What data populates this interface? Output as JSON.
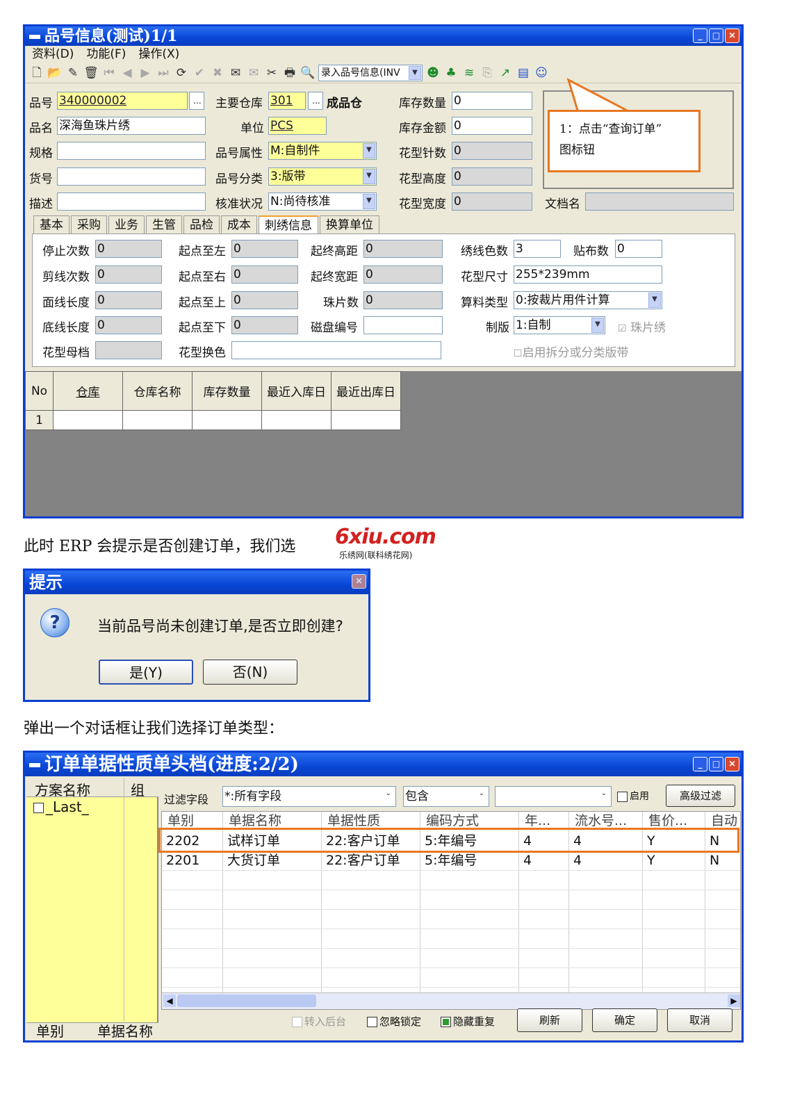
{
  "window1": {
    "title": "品号信息(测试)1/1",
    "menus": [
      "资料(D)",
      "功能(F)",
      "操作(X)"
    ],
    "toolbar_select": "录入品号信息(INV",
    "fields": {
      "item_no_label": "品号",
      "item_no": "340000002",
      "item_name_label": "品名",
      "item_name": "深海鱼珠片绣",
      "spec_label": "规格",
      "spec": "",
      "goods_no_label": "货号",
      "goods_no": "",
      "desc_label": "描述",
      "desc": "",
      "warehouse_label": "主要仓库",
      "warehouse": "301",
      "warehouse_name": "成品仓",
      "unit_label": "单位",
      "unit": "PCS",
      "attr_label": "品号属性",
      "attr": "M:自制件",
      "category_label": "品号分类",
      "category": "3:版带",
      "approve_label": "核准状况",
      "approve": "N:尚待核准",
      "stock_qty_label": "库存数量",
      "stock_qty": "0",
      "stock_amt_label": "库存金额",
      "stock_amt": "0",
      "stitch_label": "花型针数",
      "stitch": "0",
      "height_label": "花型高度",
      "height": "0",
      "width_label": "花型宽度",
      "width": "0",
      "doc_label": "文档名",
      "doc": ""
    },
    "callout": {
      "line1": "1：点击“查询订单”",
      "line2": "图标钮"
    },
    "tabs": [
      "基本",
      "采购",
      "业务",
      "生管",
      "品检",
      "成本",
      "刺绣信息",
      "换算单位"
    ],
    "active_tab": "刺绣信息",
    "embroidery": {
      "stop_label": "停止次数",
      "stop": "0",
      "cut_label": "剪线次数",
      "cut": "0",
      "face_label": "面线长度",
      "face": "0",
      "bottom_label": "底线长度",
      "bottom": "0",
      "mother_label": "花型母档",
      "mother": "",
      "sl_label": "起点至左",
      "sl": "0",
      "sr_label": "起点至右",
      "sr": "0",
      "su_label": "起点至上",
      "su": "0",
      "sd_label": "起点至下",
      "sd": "0",
      "swap_label": "花型换色",
      "swap": "",
      "eh_label": "起终高距",
      "eh": "0",
      "ew_label": "起终宽距",
      "ew": "0",
      "sequin_label": "珠片数",
      "sequin": "0",
      "disk_label": "磁盘编号",
      "disk": "",
      "colors_label": "绣线色数",
      "colors": "3",
      "patch_label": "贴布数",
      "patch": "0",
      "size_label": "花型尺寸",
      "size": "255*239mm",
      "calc_label": "算料类型",
      "calc": "0:按裁片用件计算",
      "plate_label": "制版",
      "plate": "1:自制",
      "sequin_cb": "珠片绣",
      "split_cb": "启用拆分或分类版带"
    },
    "grid": {
      "headers": [
        "No",
        "仓库",
        "仓库名称",
        "库存数量",
        "最近入库日",
        "最近出库日"
      ],
      "rows": [
        [
          "1",
          "",
          "",
          "",
          "",
          ""
        ]
      ]
    }
  },
  "text1": "此时 ERP 会提示是否创建订单，我们选",
  "watermark": {
    "brand": "6xiu.com",
    "sub": "乐绣网(联科绣花网)"
  },
  "dialog": {
    "title": "提示",
    "message": "当前品号尚未创建订单,是否立即创建?",
    "yes": "是(Y)",
    "no": "否(N)"
  },
  "text2": "弹出一个对话框让我们选择订单类型：",
  "window2": {
    "title": "订单单据性质单头档(进度:2/2)",
    "left": {
      "h1": "方案名称",
      "h2": "组",
      "item": "_Last_",
      "foot1": "单别",
      "foot2": "单据名称"
    },
    "filter": {
      "label": "过滤字段",
      "field": "*:所有字段",
      "op": "包含",
      "value": "",
      "enable": "启用",
      "advanced": "高级过滤"
    },
    "columns": [
      "单别",
      "单据名称",
      "单据性质",
      "编码方式",
      "年...",
      "流水号...",
      "售价...",
      "自动"
    ],
    "rows": [
      [
        "2202",
        "试样订单",
        "22:客户订单",
        "5:年编号",
        "4",
        "4",
        "Y",
        "N"
      ],
      [
        "2201",
        "大货订单",
        "22:客户订单",
        "5:年编号",
        "4",
        "4",
        "Y",
        "N"
      ]
    ],
    "footer": {
      "cb1": "转入后台",
      "cb2": "忽略锁定",
      "cb3": "隐藏重复",
      "refresh": "刷新",
      "ok": "确定",
      "cancel": "取消"
    }
  }
}
